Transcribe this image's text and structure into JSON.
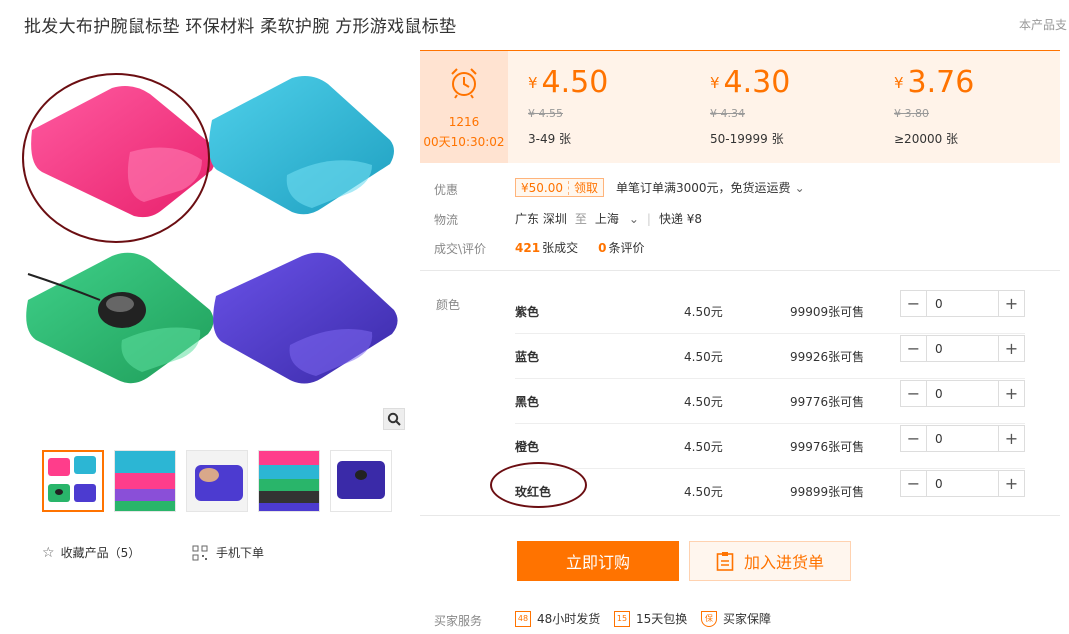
{
  "product": {
    "title": "批发大布护腕鼠标垫 环保材料 柔软护腕 方形游戏鼠标垫",
    "corner_note": "本产品支"
  },
  "gallery": {
    "favorites_label": "收藏产品（5）",
    "mobile_order_label": "手机下单",
    "thumbnails": [
      "thumb-1",
      "thumb-2",
      "thumb-3",
      "thumb-4",
      "thumb-5"
    ]
  },
  "price_panel": {
    "countdown_number": "1216",
    "countdown_time": "00天10:30:02",
    "currency": "¥",
    "tiers": [
      {
        "price": "4.50",
        "old_price": "¥ 4.55",
        "qty": "3-49 张"
      },
      {
        "price": "4.30",
        "old_price": "¥ 4.34",
        "qty": "50-19999 张"
      },
      {
        "price": "3.76",
        "old_price": "¥ 3.80",
        "qty": "≥20000 张"
      }
    ]
  },
  "info": {
    "promo_label": "优惠",
    "coupon_amount": "¥50.00",
    "coupon_get": "领取",
    "promo_text": "单笔订单满3000元，免货运运费",
    "logistics_label": "物流",
    "from": "广东 深圳",
    "to_word": "至",
    "to": "上海",
    "shipping": "快递 ¥8",
    "trade_label": "成交\\评价",
    "deals_count": "421",
    "deals_suffix": "张成交",
    "reviews_count": "0",
    "reviews_suffix": "条评价"
  },
  "sku": {
    "label": "颜色",
    "rows": [
      {
        "name": "紫色",
        "price": "4.50元",
        "stock": "99909张可售",
        "qty": "0"
      },
      {
        "name": "蓝色",
        "price": "4.50元",
        "stock": "99926张可售",
        "qty": "0"
      },
      {
        "name": "黑色",
        "price": "4.50元",
        "stock": "99776张可售",
        "qty": "0"
      },
      {
        "name": "橙色",
        "price": "4.50元",
        "stock": "99976张可售",
        "qty": "0"
      },
      {
        "name": "玫红色",
        "price": "4.50元",
        "stock": "99899张可售",
        "qty": "0"
      }
    ]
  },
  "actions": {
    "buy_label": "立即订购",
    "cart_label": "加入进货单"
  },
  "services": {
    "label": "买家服务",
    "items": [
      {
        "icon": "48",
        "text": "48小时发货"
      },
      {
        "icon": "15",
        "text": "15天包换"
      },
      {
        "icon": "保",
        "text": "买家保障"
      }
    ]
  },
  "colors": {
    "accent": "#ff7300",
    "pink": "#ff3d8b",
    "cyan": "#2cb6d4",
    "green": "#29b56a",
    "purple": "#4c3bd0"
  }
}
